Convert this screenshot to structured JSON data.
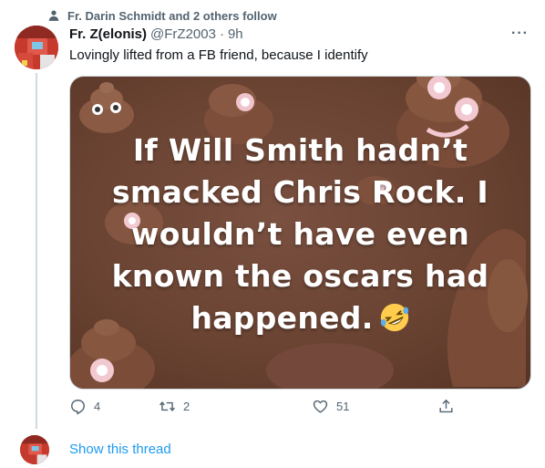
{
  "social_context": {
    "text": "Fr. Darin Schmidt and 2 others follow",
    "icon": "person-icon"
  },
  "tweet": {
    "display_name": "Fr. Z(elonis)",
    "handle": "@FrZ2003",
    "separator": "·",
    "time": "9h",
    "more_label": "···",
    "text": "Lovingly lifted from a FB friend, because I identify",
    "media": {
      "lines": [
        "If Will Smith hadn’t",
        "smacked Chris Rock. I",
        "wouldn’t have even",
        "known the oscars had",
        "happened."
      ],
      "emoji": "rolling-on-floor-laughing",
      "background": "#6a4332"
    },
    "actions": {
      "reply": {
        "icon": "reply-icon",
        "count": "4"
      },
      "retweet": {
        "icon": "retweet-icon",
        "count": "2"
      },
      "like": {
        "icon": "heart-icon",
        "count": "51"
      },
      "share": {
        "icon": "share-icon",
        "count": ""
      }
    }
  },
  "show_thread": "Show this thread",
  "colors": {
    "link": "#1d9bf0",
    "muted": "#536471",
    "line": "#cfd9de"
  }
}
